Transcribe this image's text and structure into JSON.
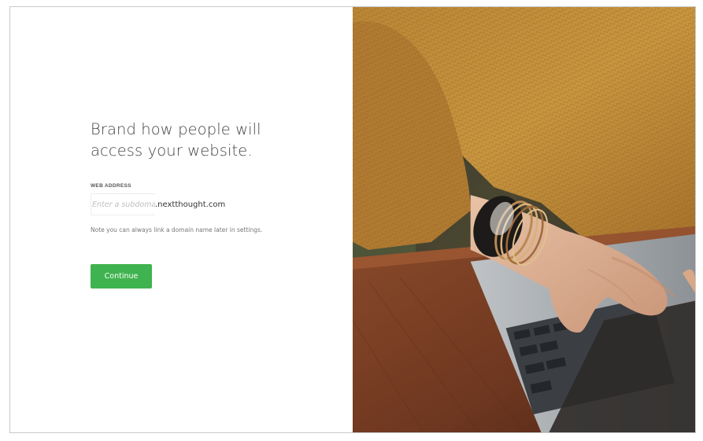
{
  "onboarding": {
    "headline_line1": "Brand how people will",
    "headline_line2": "access your website.",
    "web_address_label": "WEB ADDRESS",
    "subdomain_placeholder": "Enter a subdomain",
    "subdomain_value": "",
    "domain_suffix": ".nextthought.com",
    "note": "Note you can always link a domain name later in settings.",
    "continue_label": "Continue"
  },
  "hero_image": {
    "icon": "photo-person-with-laptop"
  },
  "colors": {
    "accent": "#3fb34f",
    "headline": "#444444"
  }
}
